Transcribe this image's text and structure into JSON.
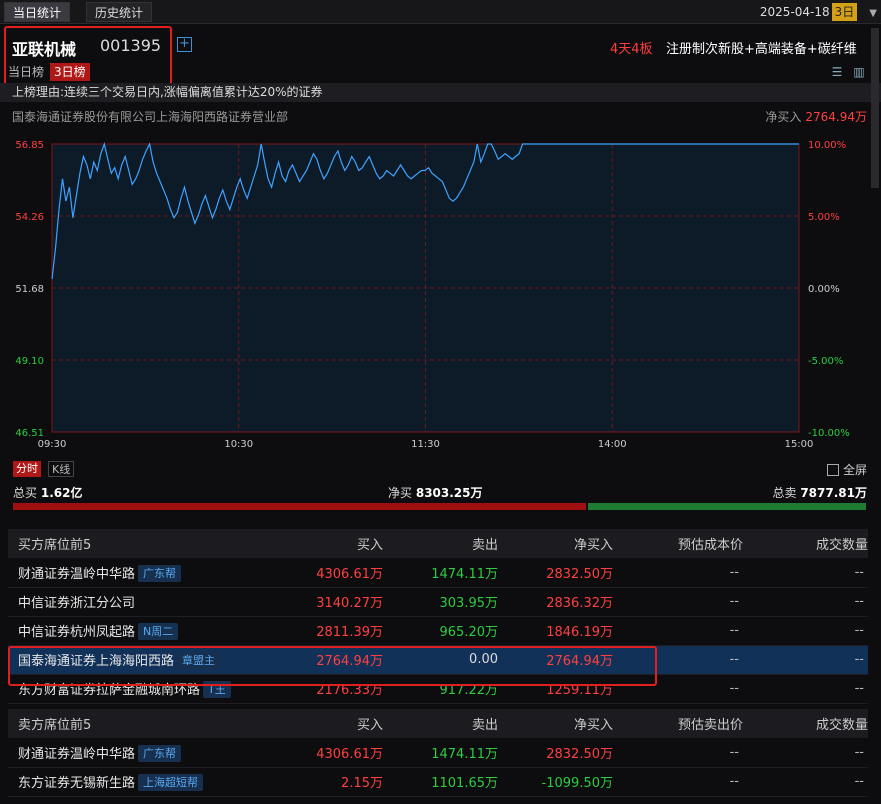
{
  "topbar": {
    "tabs": [
      "当日统计",
      "历史统计"
    ],
    "date": "2025-04-18",
    "period_badge": "3日"
  },
  "stock": {
    "name": "亚联机械",
    "code": "001395",
    "streak": "4天4板",
    "concepts": "注册制次新股+高端装备+碳纤维",
    "subtabs": [
      "当日榜",
      "3日榜"
    ]
  },
  "reason": "上榜理由:连续三个交易日内,涨幅偏离值累计达20%的证券",
  "broker": {
    "name": "国泰海通证券股份有限公司上海海阳西路证券营业部",
    "net_label": "净买入",
    "net_value": "2764.94万"
  },
  "chart_data": {
    "type": "line",
    "title": "",
    "x_ticks": [
      "09:30",
      "10:30",
      "11:30",
      "14:00",
      "15:00"
    ],
    "y_ticks_price": [
      "56.85",
      "54.26",
      "51.68",
      "49.10",
      "46.51"
    ],
    "y_ticks_pct": [
      "10.00%",
      "5.00%",
      "0.00%",
      "-5.00%",
      "-10.00%"
    ],
    "ylim": [
      46.51,
      56.85
    ],
    "prev_close": 51.68,
    "color": "#3ea2ff",
    "series": [
      {
        "values": [
          52.0,
          53.1,
          54.5,
          55.6,
          54.8,
          55.3,
          54.2,
          55.0,
          55.8,
          56.4,
          56.1,
          55.6,
          56.2,
          55.9,
          56.5,
          56.85,
          56.3,
          55.8,
          56.0,
          55.6,
          56.1,
          56.4,
          55.9,
          55.4,
          55.6,
          55.9,
          56.3,
          56.6,
          56.85,
          56.2,
          55.8,
          55.5,
          55.2,
          54.9,
          54.5,
          54.2,
          54.4,
          54.9,
          55.3,
          54.8,
          54.4,
          54.0,
          54.3,
          54.7,
          55.0,
          54.6,
          54.2,
          54.5,
          54.9,
          55.2,
          54.8,
          54.5,
          54.9,
          55.3,
          55.6,
          55.2,
          54.9,
          55.3,
          55.7,
          56.1,
          56.85,
          56.2,
          55.6,
          55.3,
          55.8,
          56.2,
          55.7,
          55.5,
          55.9,
          56.1,
          55.8,
          55.5,
          55.7,
          55.9,
          56.2,
          56.5,
          56.3,
          55.9,
          55.6,
          55.8,
          56.1,
          56.4,
          56.6,
          56.2,
          55.9,
          56.1,
          56.4,
          56.2,
          55.9,
          56.0,
          56.2,
          56.4,
          56.1,
          55.8,
          55.6,
          55.7,
          55.9,
          55.8,
          55.7,
          55.9,
          56.1,
          55.9,
          55.7,
          55.6,
          55.7,
          55.8,
          55.9,
          55.9,
          56.0,
          55.8,
          55.7,
          55.6,
          55.5,
          55.2,
          54.9,
          54.8,
          54.9,
          55.1,
          55.3,
          55.6,
          55.9,
          56.2,
          56.85,
          56.2,
          56.5,
          56.85,
          56.85,
          56.6,
          56.3,
          56.4,
          56.5,
          56.4,
          56.3,
          56.4,
          56.5,
          56.85
        ]
      }
    ]
  },
  "chart_tabs": [
    "分时",
    "K线"
  ],
  "fullscreen_label": "全屏",
  "totals": {
    "buy_label": "总买",
    "buy_value": "1.62亿",
    "net_label": "净买",
    "net_value": "8303.25万",
    "sell_label": "总卖",
    "sell_value": "7877.81万"
  },
  "buy_table": {
    "headers": [
      "买方席位前5",
      "买入",
      "卖出",
      "净买入",
      "预估成本价",
      "成交数量"
    ],
    "rows": [
      {
        "name": "财通证券温岭中华路",
        "tag": "广东帮",
        "buy": "4306.61万",
        "sell": "1474.11万",
        "net": "2832.50万",
        "cost": "--",
        "qty": "--"
      },
      {
        "name": "中信证券浙江分公司",
        "tag": "",
        "buy": "3140.27万",
        "sell": "303.95万",
        "net": "2836.32万",
        "cost": "--",
        "qty": "--"
      },
      {
        "name": "中信证券杭州凤起路",
        "tag": "N周二",
        "buy": "2811.39万",
        "sell": "965.20万",
        "net": "1846.19万",
        "cost": "--",
        "qty": "--"
      },
      {
        "name": "国泰海通证券上海海阳西路",
        "tag": "章盟主",
        "buy": "2764.94万",
        "sell": "0.00",
        "net": "2764.94万",
        "cost": "--",
        "qty": "--"
      },
      {
        "name": "东方财富证券拉萨金融城南环路",
        "tag": "T王",
        "buy": "2176.33万",
        "sell": "917.22万",
        "net": "1259.11万",
        "cost": "--",
        "qty": "--"
      }
    ]
  },
  "sell_table": {
    "headers": [
      "卖方席位前5",
      "买入",
      "卖出",
      "净买入",
      "预估卖出价",
      "成交数量"
    ],
    "rows": [
      {
        "name": "财通证券温岭中华路",
        "tag": "广东帮",
        "buy": "4306.61万",
        "sell": "1474.11万",
        "net": "2832.50万",
        "cost": "--",
        "qty": "--"
      },
      {
        "name": "东方证券无锡新生路",
        "tag": "上海超短帮",
        "buy": "2.15万",
        "sell": "1101.65万",
        "net": "-1099.50万",
        "cost": "--",
        "qty": "--"
      }
    ]
  }
}
